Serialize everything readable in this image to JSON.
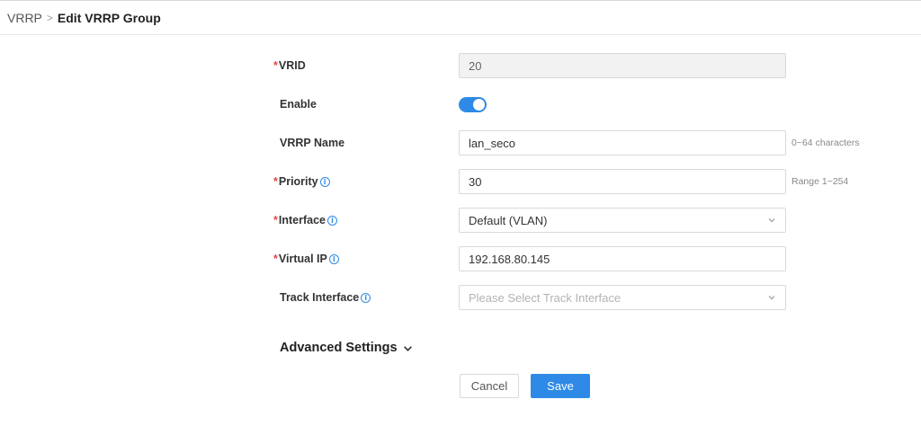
{
  "breadcrumb": {
    "parent": "VRRP",
    "separator": ">",
    "current": "Edit VRRP Group"
  },
  "form": {
    "required_mark": "*",
    "info_glyph": "i",
    "vrid": {
      "label": "VRID",
      "value": "20"
    },
    "enable": {
      "label": "Enable",
      "on": true
    },
    "vrrp_name": {
      "label": "VRRP Name",
      "value": "lan_seco",
      "hint": "0~64 characters"
    },
    "priority": {
      "label": "Priority",
      "value": "30",
      "hint": "Range 1~254"
    },
    "interface": {
      "label": "Interface",
      "value": "Default (VLAN)"
    },
    "virtual_ip": {
      "label": "Virtual IP",
      "value": "192.168.80.145"
    },
    "track_interface": {
      "label": "Track Interface",
      "placeholder": "Please Select Track Interface"
    }
  },
  "advanced": {
    "label": "Advanced Settings"
  },
  "actions": {
    "cancel": "Cancel",
    "save": "Save"
  },
  "colors": {
    "primary": "#2e8ae6",
    "required": "#e54545",
    "disabled_bg": "#f2f2f2",
    "border": "#d9d9d9"
  },
  "icons": {
    "info": "info-icon",
    "dropdown": "chevron-down-icon",
    "expand": "chevron-down-icon"
  }
}
